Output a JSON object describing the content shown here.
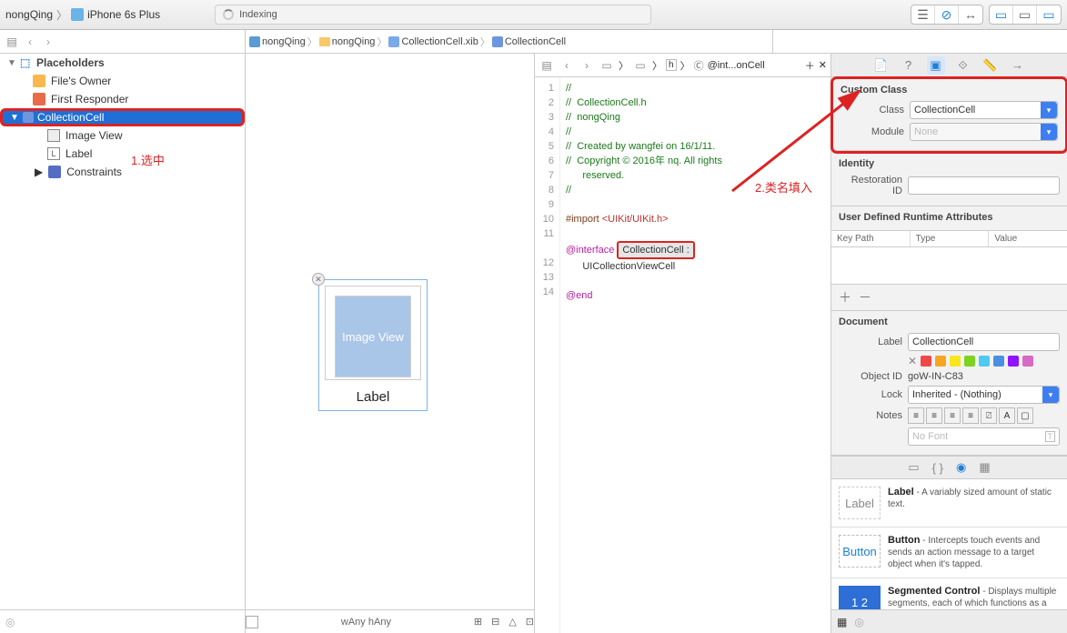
{
  "toolbar": {
    "scheme_target": "nongQing",
    "scheme_device": "iPhone 6s Plus",
    "status": "Indexing"
  },
  "jumpbar": {
    "left_crumbs": [
      "nongQing",
      "nongQing",
      "CollectionCell.xib",
      "CollectionCell"
    ],
    "assistant_crumb": "@int...onCell"
  },
  "navigator": {
    "placeholders_label": "Placeholders",
    "files_owner": "File's Owner",
    "first_responder": "First Responder",
    "root_cell": "CollectionCell",
    "children": {
      "image_view": "Image View",
      "label": "Label",
      "constraints": "Constraints"
    }
  },
  "annotations": {
    "step1": "1.选中",
    "step2": "2.类名填入"
  },
  "canvas": {
    "image_view_text": "Image View",
    "label_text": "Label",
    "size_w": "wAny",
    "size_h": "hAny"
  },
  "code": {
    "lines": [
      "//",
      "//  CollectionCell.h",
      "//  nongQing",
      "//",
      "//  Created by wangfei on 16/1/11.",
      "//  Copyright © 2016年 nq. All rights reserved.",
      "//",
      "",
      "#import <UIKit/UIKit.h>",
      "",
      "@interface CollectionCell : UICollectionViewCell",
      "",
      "@end",
      ""
    ],
    "highlight": "CollectionCell :",
    "file_type": "h"
  },
  "inspector": {
    "custom_class": {
      "title": "Custom Class",
      "class_label": "Class",
      "class_value": "CollectionCell",
      "module_label": "Module",
      "module_placeholder": "None"
    },
    "identity": {
      "title": "Identity",
      "restoration_label": "Restoration ID",
      "restoration_value": ""
    },
    "runtime_attrs": {
      "title": "User Defined Runtime Attributes",
      "col_key": "Key Path",
      "col_type": "Type",
      "col_value": "Value"
    },
    "document": {
      "title": "Document",
      "label_label": "Label",
      "label_value": "CollectionCell",
      "object_id_label": "Object ID",
      "object_id_value": "goW-IN-C83",
      "lock_label": "Lock",
      "lock_value": "Inherited - (Nothing)",
      "notes_label": "Notes",
      "no_font": "No Font",
      "colors": [
        "#f04848",
        "#f5a623",
        "#f8e71c",
        "#7ed321",
        "#50c8f0",
        "#4a90e2",
        "#9013fe",
        "#d669c4"
      ]
    },
    "library": {
      "label": {
        "title": "Label",
        "icon_text": "Label",
        "desc": " - A variably sized amount of static text."
      },
      "button": {
        "title": "Button",
        "icon_text": "Button",
        "desc": " - Intercepts touch events and sends an action message to a target object when it's tapped."
      },
      "segmented": {
        "title": "Segmented Control",
        "icon_text": "1 2",
        "desc": " - Displays multiple segments, each of which functions as a discrete button."
      }
    }
  }
}
